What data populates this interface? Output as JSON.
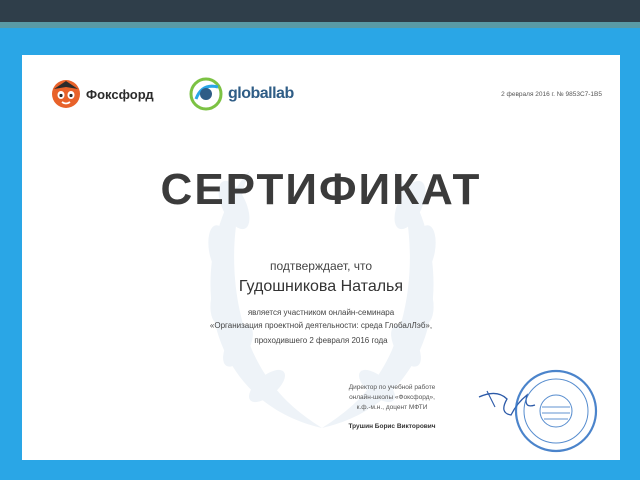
{
  "brand": {
    "foxford": "Фоксфорд",
    "globallab": "globallab"
  },
  "meta": {
    "date_number": "2 февраля 2016 г.   № 9853C7-1B5"
  },
  "certificate": {
    "title": "СЕРТИФИКАТ",
    "confirms": "подтверждает, что",
    "person": "Гудошникова Наталья",
    "line1": "является участником онлайн-семинара",
    "line2": "«Организация проектной деятельности: среда ГлобалЛэб»,",
    "line3": "проходившего 2 февраля 2016 года"
  },
  "signature_block": {
    "role1": "Директор по учебной работе",
    "role2": "онлайн-школы «Фоксфорд»,",
    "role3": "к.ф.-м.н., доцент МФТИ",
    "name": "Трушин Борис Викторович"
  },
  "colors": {
    "background": "#2aa6e6",
    "paper": "#ffffff",
    "title": "#3b3b3b",
    "wreath": "#eef3f8",
    "stamp": "#2c6fc2"
  }
}
